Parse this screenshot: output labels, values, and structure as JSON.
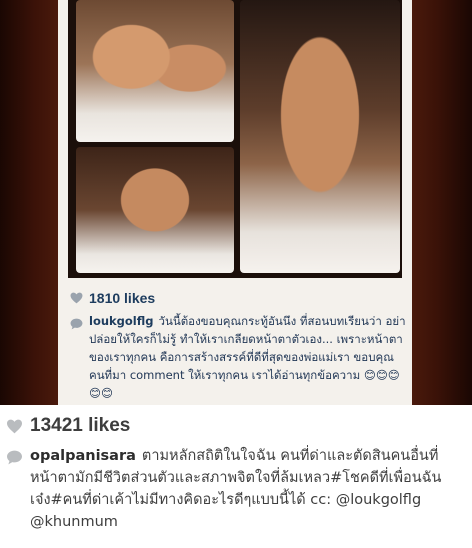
{
  "repost": {
    "likes": "1810 likes",
    "comment": {
      "username": "loukgolflg",
      "text": "วันนี้ต้องขอบคุณกระทู้อันนึง ที่สอนบทเรียนว่า อย่าปล่อยให้ใครก็ไม่รู้ ทำให้เราเกลียดหน้าตาตัวเอง... เพราะหน้าตาของเราทุกคน คือการสร้างสรรค์ที่ดีที่สุดของพ่อแม่เรา ขอบคุณคนที่มา comment ให้เราทุกคน เราได้อ่านทุกข้อความ 😊😊😊😊😊"
    }
  },
  "post": {
    "likes": "13421 likes",
    "comment": {
      "username": "opalpanisara",
      "text": "ตามหลักสถิติในใจฉัน คนที่ด่าและตัดสินคนอื่นที่หน้าตามักมีชีวิตส่วนตัวและสภาพจิตใจที่ล้มเหลว#โชคดีที่เพื่อนฉันเจ๋ง#คนที่ด่าเค้าไม่มีทางคิดอะไรดีๆแบบนี้ได้ cc: @loukgolflg @khunmum"
    }
  },
  "colors": {
    "bezel": "#2b0c05",
    "repost_text": "#1f3554",
    "post_text": "#3e3e3e"
  }
}
